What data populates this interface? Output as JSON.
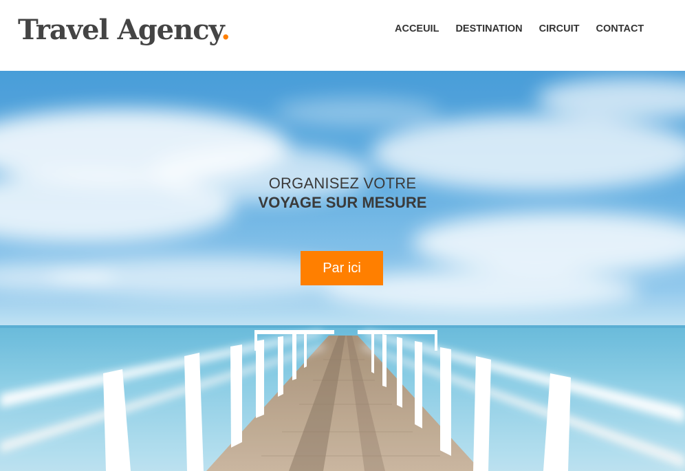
{
  "header": {
    "logo_text": "Travel Agency",
    "logo_dot": "."
  },
  "nav": {
    "items": [
      {
        "label": "ACCEUIL"
      },
      {
        "label": "DESTINATION"
      },
      {
        "label": "CIRCUIT"
      },
      {
        "label": "CONTACT"
      }
    ]
  },
  "hero": {
    "title_line1": "ORGANISEZ VOTRE",
    "title_line2": "VOYAGE SUR MESURE",
    "cta_label": "Par ici"
  },
  "colors": {
    "accent": "#ff7f00",
    "text": "#333333"
  }
}
